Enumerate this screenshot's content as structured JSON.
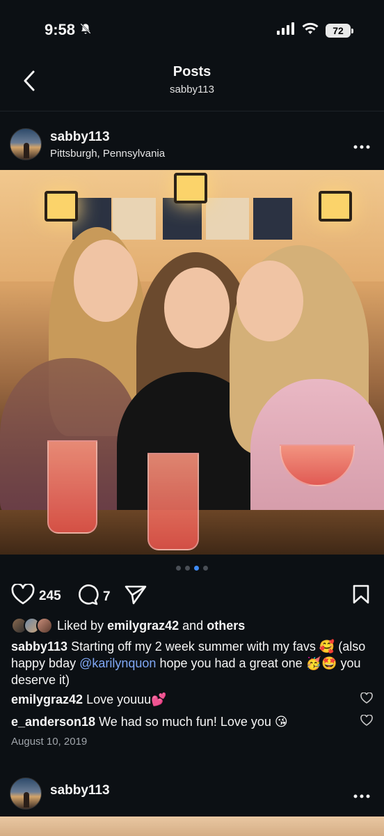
{
  "status": {
    "time": "9:58",
    "battery": "72"
  },
  "nav": {
    "title": "Posts",
    "subtitle": "sabby113"
  },
  "post": {
    "username": "sabby113",
    "location": "Pittsburgh, Pennsylvania",
    "carousel_dots": 4,
    "active_dot": 2,
    "likes": "245",
    "comments_count": "7",
    "liked_by_prefix": "Liked by",
    "liked_by_user": "emilygraz42",
    "liked_by_and": "and",
    "liked_by_others": "others",
    "caption_user": "sabby113",
    "caption_text_1": "Starting off my 2 week summer with my favs 🥰 (also happy bday",
    "caption_mention": "@karilynquon",
    "caption_text_2": "hope you had a great one 🥳🤩 you deserve it)",
    "comments": [
      {
        "user": "emilygraz42",
        "text": "Love youuu💕"
      },
      {
        "user": "e_anderson18",
        "text": "We had so much fun! Love you 😘"
      }
    ],
    "date": "August 10, 2019"
  },
  "next_post": {
    "username": "sabby113"
  },
  "colors": {
    "background": "#0c1014",
    "mention": "#7fa7f5",
    "active_dot": "#3f8bf5"
  }
}
